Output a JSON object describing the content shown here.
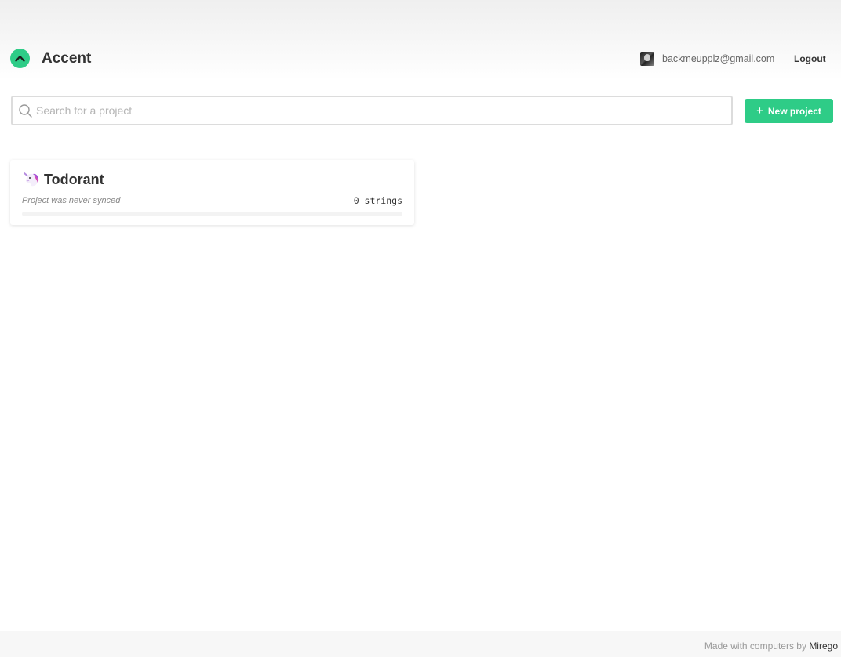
{
  "header": {
    "app_title": "Accent",
    "user_email": "backmeupplz@gmail.com",
    "logout_label": "Logout"
  },
  "search": {
    "placeholder": "Search for a project",
    "value": ""
  },
  "new_project": {
    "label": "New project",
    "icon": "plus-icon"
  },
  "projects": [
    {
      "emoji": "unicorn-icon",
      "name": "Todorant",
      "sync_status": "Project was never synced",
      "strings": "0 strings",
      "progress": 0
    }
  ],
  "footer": {
    "text": "Made with computers by",
    "link": "Mirego"
  },
  "colors": {
    "accent": "#2ecc87",
    "text": "#333333",
    "muted": "#888888"
  }
}
